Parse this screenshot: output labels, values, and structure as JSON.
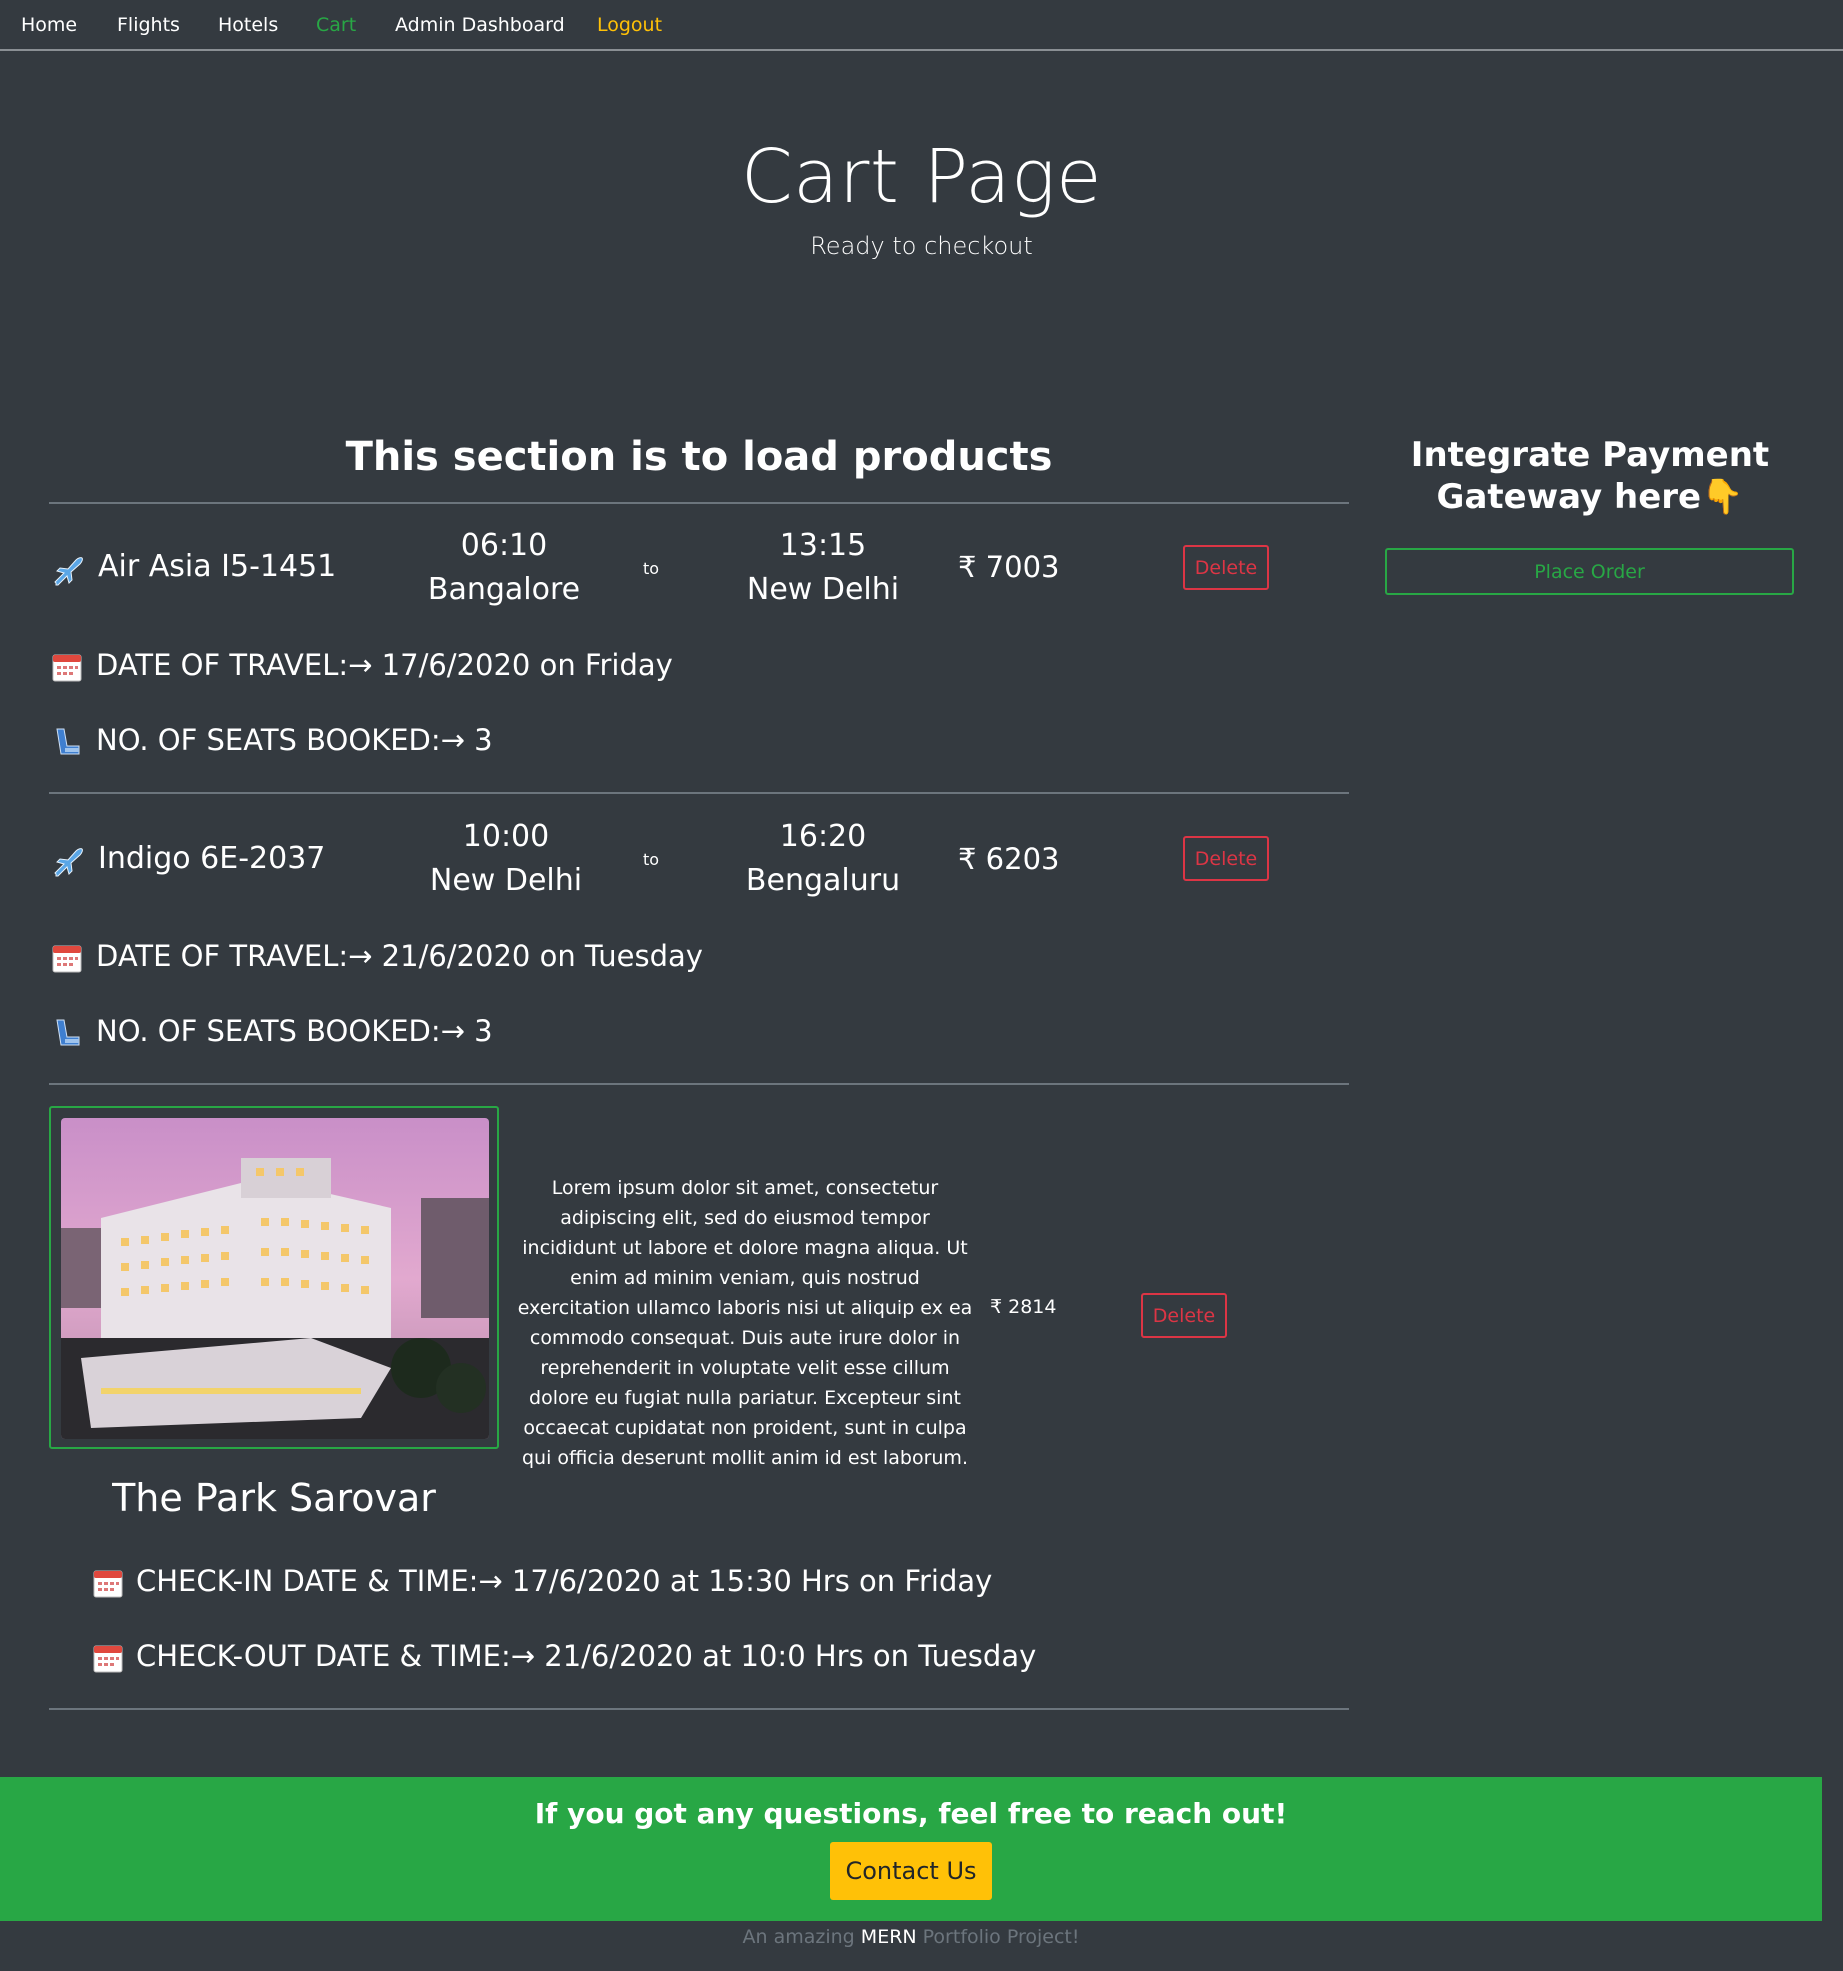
{
  "nav": {
    "home": "Home",
    "flights": "Flights",
    "hotels": "Hotels",
    "cart": "Cart",
    "admin": "Admin Dashboard",
    "logout": "Logout"
  },
  "hero": {
    "title": "Cart Page",
    "subtitle": "Ready to checkout"
  },
  "products": {
    "heading": "This section is to load products",
    "flights": [
      {
        "name": "Air Asia I5-1451",
        "dep_time": "06:10",
        "dep_city": "Bangalore",
        "to": "to",
        "arr_time": "13:15",
        "arr_city": "New Delhi",
        "price": "₹ 7003",
        "delete": "Delete",
        "date_line": "DATE OF TRAVEL:→ 17/6/2020 on Friday",
        "seats_line": "NO. OF SEATS BOOKED:→ 3"
      },
      {
        "name": "Indigo 6E-2037",
        "dep_time": "10:00",
        "dep_city": "New Delhi",
        "to": "to",
        "arr_time": "16:20",
        "arr_city": "Bengaluru",
        "price": "₹ 6203",
        "delete": "Delete",
        "date_line": "DATE OF TRAVEL:→ 21/6/2020 on Tuesday",
        "seats_line": "NO. OF SEATS BOOKED:→ 3"
      }
    ],
    "hotel": {
      "name": "The Park Sarovar",
      "description": "Lorem ipsum dolor sit amet, consectetur adipiscing elit, sed do eiusmod tempor incididunt ut labore et dolore magna aliqua. Ut enim ad minim veniam, quis nostrud exercitation ullamco laboris nisi ut aliquip ex ea commodo consequat. Duis aute irure dolor in reprehenderit in voluptate velit esse cillum dolore eu fugiat nulla pariatur. Excepteur sint occaecat cupidatat non proident, sunt in culpa qui officia deserunt mollit anim id est laborum.",
      "price": "₹ 2814",
      "delete": "Delete",
      "checkin": "CHECK-IN DATE & TIME:→ 17/6/2020 at 15:30 Hrs on Friday",
      "checkout": "CHECK-OUT DATE & TIME:→ 21/6/2020 at 10:0 Hrs on Tuesday"
    }
  },
  "sidebar": {
    "title": "Integrate Payment Gateway here👇",
    "place_order": "Place Order"
  },
  "footer": {
    "question": "If you got any questions, feel free to reach out!",
    "contact": "Contact Us",
    "credit_prefix": "An amazing ",
    "credit_highlight": "MERN",
    "credit_suffix": " Portfolio Project!"
  },
  "colors": {
    "background": "#343a40",
    "success": "#28a745",
    "danger": "#dc3545",
    "warning": "#ffc107"
  },
  "icons": [
    "airplane-icon",
    "calendar-icon",
    "seat-icon",
    "pointing-down-icon"
  ]
}
